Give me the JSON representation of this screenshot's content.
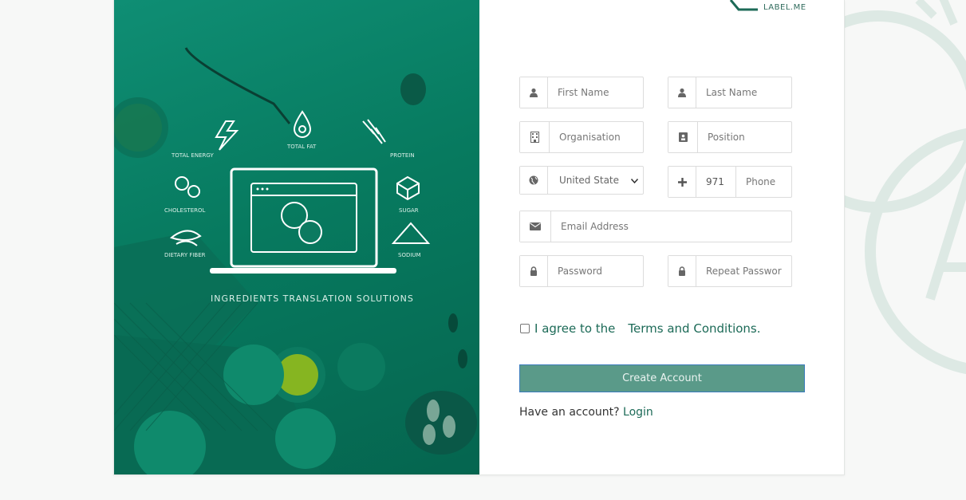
{
  "brand": {
    "logo_text": "LABEL.ME"
  },
  "hero": {
    "tagline": "INGREDIENTS TRANSLATION SOLUTIONS",
    "nutrients": {
      "energy": "TOTAL ENERGY",
      "fat": "TOTAL FAT",
      "protein": "PROTEIN",
      "cholesterol": "CHOLESTEROL",
      "sugar": "SUGAR",
      "fiber": "DIETARY FIBER",
      "sodium": "SODIUM"
    }
  },
  "form": {
    "first_name": {
      "placeholder": "First Name",
      "icon": "user-icon"
    },
    "last_name": {
      "placeholder": "Last Name",
      "icon": "user-icon"
    },
    "organisation": {
      "placeholder": "Organisation",
      "icon": "building-icon"
    },
    "position": {
      "placeholder": "Position",
      "icon": "id-badge-icon"
    },
    "country": {
      "value": "United State",
      "icon": "globe-icon"
    },
    "phone_code": {
      "value": "971",
      "icon": "plus-icon"
    },
    "phone": {
      "placeholder": "Phone"
    },
    "email": {
      "placeholder": "Email Address",
      "icon": "envelope-icon"
    },
    "password": {
      "placeholder": "Password",
      "icon": "lock-icon"
    },
    "repeat_password": {
      "placeholder": "Repeat Passwor",
      "icon": "lock-icon"
    },
    "agree_text": "I agree to the",
    "terms_link": "Terms and Conditions.",
    "submit_label": "Create Account",
    "have_account": "Have an account?",
    "login_link": "Login"
  },
  "colors": {
    "brand_green": "#077a5f",
    "button": "#5a9a89",
    "link": "#1c6a57"
  }
}
